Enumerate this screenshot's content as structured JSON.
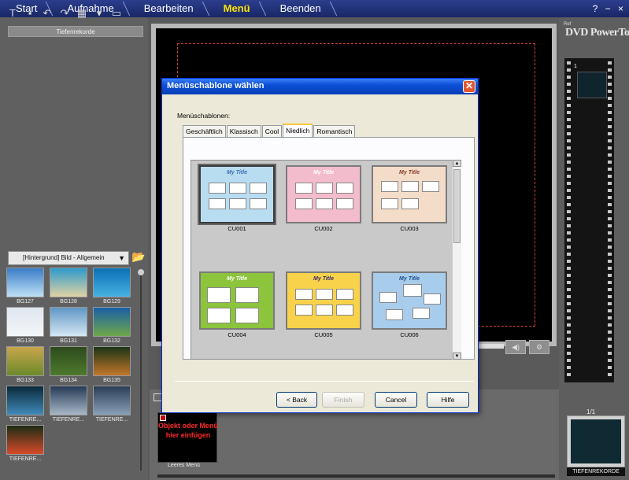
{
  "nav": {
    "items": [
      "Start",
      "Aufnahme",
      "Bearbeiten",
      "Menü",
      "Beenden"
    ],
    "active": "Menü",
    "window_controls": "? − ×"
  },
  "left": {
    "label": "Tiefenrekorde",
    "dropdown_value": "[Hintergrund] Bild - Allgemein",
    "thumbs": [
      {
        "caption": "BG127",
        "colors": [
          "#3a7cc8",
          "#bfe2f5"
        ]
      },
      {
        "caption": "BG128",
        "colors": [
          "#2c9acb",
          "#e0d2a4"
        ]
      },
      {
        "caption": "BG129",
        "colors": [
          "#0c6fb4",
          "#48b2e2"
        ]
      },
      {
        "caption": "BG130",
        "colors": [
          "#dfe6ef",
          "#f4f6f8"
        ]
      },
      {
        "caption": "BG131",
        "colors": [
          "#5f97c5",
          "#d6e7f4"
        ]
      },
      {
        "caption": "BG132",
        "colors": [
          "#1a5fa8",
          "#6ea84a"
        ]
      },
      {
        "caption": "BG133",
        "colors": [
          "#c9a54a",
          "#6c8a2c"
        ]
      },
      {
        "caption": "BG134",
        "colors": [
          "#2d4a1c",
          "#4d7a2c"
        ]
      },
      {
        "caption": "BG135",
        "colors": [
          "#1c3416",
          "#c2762a"
        ]
      },
      {
        "caption": "TIEFENRE...",
        "colors": [
          "#0a2a3a",
          "#3f8ab8"
        ]
      },
      {
        "caption": "TIEFENRE...",
        "colors": [
          "#263a56",
          "#a8b8c8"
        ]
      },
      {
        "caption": "TIEFENRE...",
        "colors": [
          "#2a3e56",
          "#8aa0b8"
        ]
      },
      {
        "caption": "TIEFENRE...",
        "colors": [
          "#1c2c14",
          "#d84a2a"
        ]
      }
    ]
  },
  "dialog": {
    "title": "Menüschablone wählen",
    "close_glyph": "✕",
    "templates_label": "Menüschablonen:",
    "tabs": [
      "Geschäftlich",
      "Klassisch",
      "Cool",
      "Niedlich",
      "Romantisch"
    ],
    "active_tab": "Niedlich",
    "templates": [
      {
        "name": "CU001",
        "title": "My Title",
        "bg": "#b8dcf0",
        "accent": "#3d6fb0",
        "boxes": "grid6"
      },
      {
        "name": "CU002",
        "title": "My Title",
        "bg": "#f2bccc",
        "accent": "#ffffff",
        "boxes": "grid6"
      },
      {
        "name": "CU003",
        "title": "My Title",
        "bg": "#f3dcc8",
        "accent": "#8a3a2a",
        "boxes": "grid5"
      },
      {
        "name": "CU004",
        "title": "My Title",
        "bg": "#8cc43c",
        "accent": "#ffffff",
        "boxes": "grid4"
      },
      {
        "name": "CU005",
        "title": "My Title",
        "bg": "#f7d24a",
        "accent": "#3a2a6a",
        "boxes": "grid6"
      },
      {
        "name": "CU006",
        "title": "My Title",
        "bg": "#a8ccec",
        "accent": "#1d4d8a",
        "boxes": "scatter"
      }
    ],
    "buttons": {
      "back": "< Back",
      "finish": "Finish",
      "cancel": "Cancel",
      "help": "Hilfe"
    }
  },
  "bottom": {
    "dropzone_text": "Objekt oder Menü hier einfügen",
    "dropzone_label": "Leeres Menü"
  },
  "right": {
    "brand": "DVD PowerTools",
    "brand_prefix": "Ref",
    "film_number": "1",
    "counter": "1/1",
    "thumb_label": "TIEFENREKORDE"
  }
}
